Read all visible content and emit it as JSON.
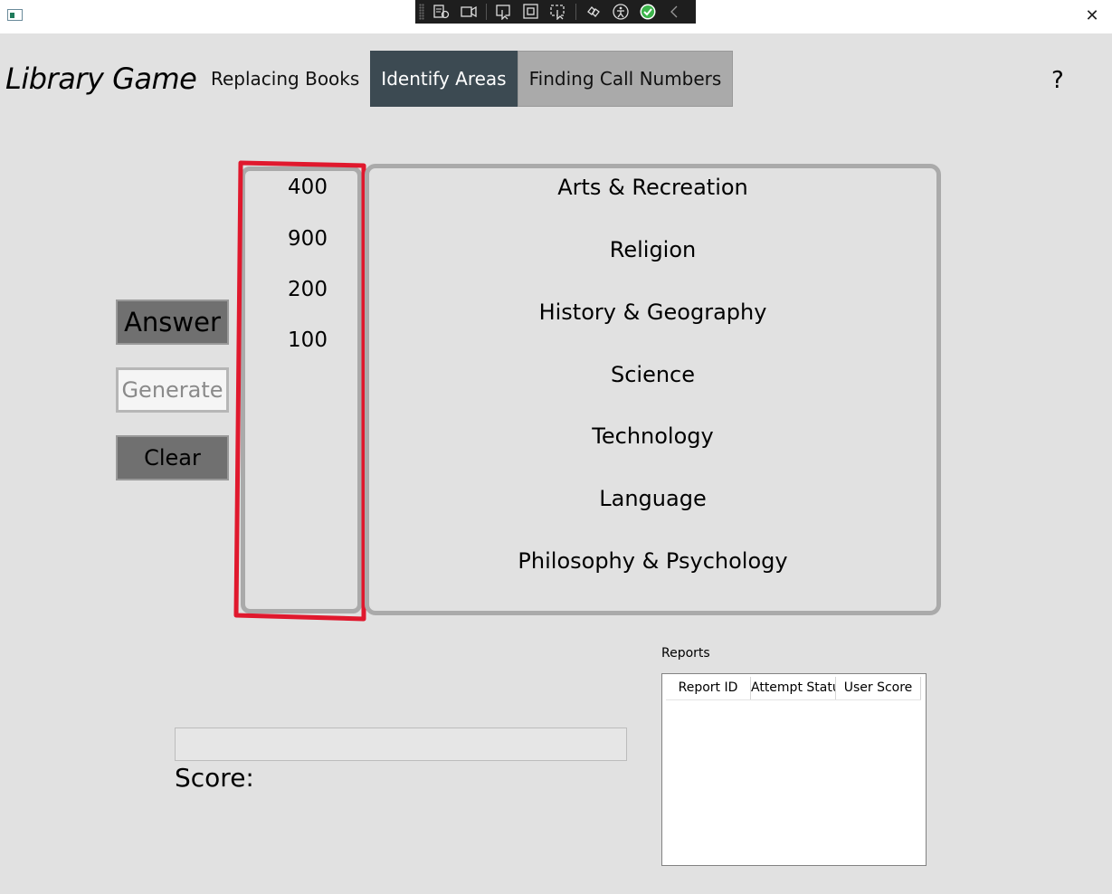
{
  "window": {
    "close_glyph": "✕",
    "app_icon": "app-window-icon"
  },
  "debug_toolbar": {
    "icons": [
      "live-visual-tree-icon",
      "camera-icon",
      "select-element-icon",
      "display-layout-adorners-icon",
      "track-focus-icon",
      "binding-failures-icon",
      "accessibility-icon",
      "checkmark-icon",
      "collapse-chevron-icon"
    ],
    "check_color": "#3cb44b"
  },
  "header": {
    "app_title": "Library Game",
    "tabs": [
      {
        "label": "Replacing Books"
      },
      {
        "label": "Identify Areas"
      },
      {
        "label": "Finding Call Numbers"
      }
    ],
    "active_tab": "Identify Areas",
    "help_label": "?"
  },
  "controls": {
    "answer_label": "Answer",
    "generate_label": "Generate",
    "clear_label": "Clear"
  },
  "numbers": [
    "400",
    "900",
    "200",
    "100"
  ],
  "areas": [
    "Arts & Recreation",
    "Religion",
    "History & Geography",
    "Science",
    "Technology",
    "Language",
    "Philosophy & Psychology"
  ],
  "score": {
    "label": "Score:"
  },
  "reports": {
    "title": "Reports",
    "columns": [
      "Report ID",
      "Attempt Status",
      "User Score"
    ],
    "rows": []
  },
  "colors": {
    "background": "#e1e1e1",
    "active_tab": "#3c4a52",
    "highlight": "#e0182d",
    "panel_border": "#aaaaaa"
  }
}
